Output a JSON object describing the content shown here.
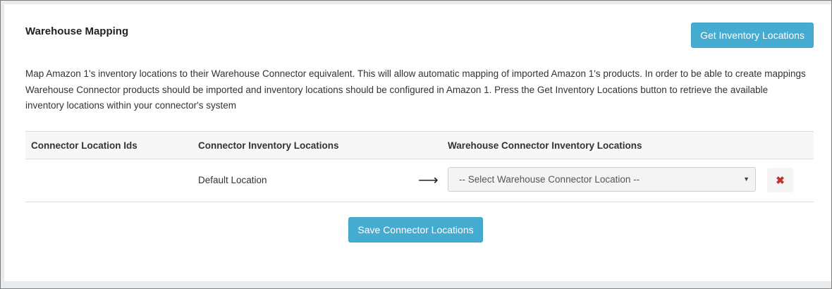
{
  "card": {
    "title": "Warehouse Mapping",
    "get_button": "Get Inventory Locations",
    "description": "Map Amazon 1's inventory locations to their Warehouse Connector equivalent. This will allow automatic mapping of imported Amazon 1's products. In order to be able to create mappings Warehouse Connector products should be imported and inventory locations should be configured in Amazon 1. Press the Get Inventory Locations button to retrieve the available inventory locations within your connector's system"
  },
  "table": {
    "headers": [
      "Connector Location Ids",
      "Connector Inventory Locations",
      "Warehouse Connector Inventory Locations"
    ],
    "rows": [
      {
        "location_id": "",
        "inventory_location": "Default Location",
        "select_placeholder": "-- Select Warehouse Connector Location --"
      }
    ]
  },
  "icons": {
    "arrow": "arrow-right-icon",
    "delete": "close-icon",
    "caret": "caret-down-icon"
  },
  "save_button": "Save Connector Locations",
  "colors": {
    "primary": "#46abd0",
    "danger": "#c9302c"
  }
}
